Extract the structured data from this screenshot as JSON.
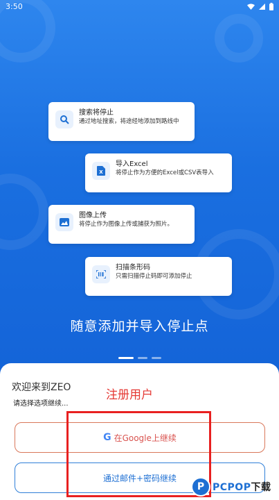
{
  "status_bar": {
    "time": "3:50",
    "icons": [
      "wifi-icon",
      "signal-icon",
      "battery-icon"
    ]
  },
  "features": [
    {
      "icon": "search-icon",
      "title": "搜索将停止",
      "desc": "通过地址搜索，将途经地添加到路线中"
    },
    {
      "icon": "excel-icon",
      "title": "导入Excel",
      "desc": "将停止作为方便的Excel或CSV表导入"
    },
    {
      "icon": "image-icon",
      "title": "图像上传",
      "desc": "将停止作为图像上传或捕获为照片。"
    },
    {
      "icon": "barcode-icon",
      "title": "扫描条形码",
      "desc": "只需扫描停止码即可添加停止"
    }
  ],
  "tagline": "随意添加并导入停止点",
  "carousel": {
    "pages": 3,
    "active": 0
  },
  "sheet": {
    "welcome": "欢迎来到ZEO",
    "subtitle": "请选择选项继续...",
    "google_button": "在Google上继续",
    "google_letter": "G",
    "email_button": "通过邮件+密码继续"
  },
  "annotation": {
    "label": "注册用户",
    "color": "#e53935"
  },
  "watermark": {
    "logo_letter": "P",
    "brand": "PCPOP",
    "suffix": "下载"
  },
  "colors": {
    "primary": "#1a6fe0",
    "google_border": "#d9775a",
    "email_border": "#2f7fd8",
    "annotation_red": "#e82020"
  }
}
